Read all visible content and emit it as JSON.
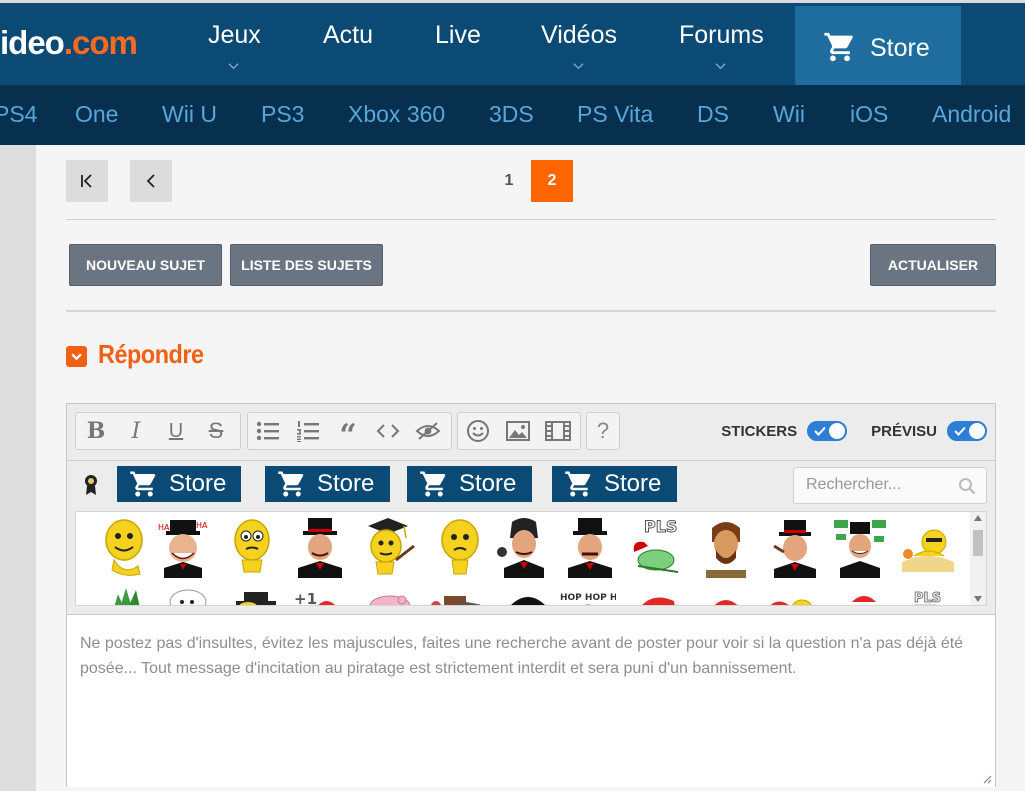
{
  "header": {
    "logo_main": "ideo",
    "logo_dot": ".com",
    "nav": [
      {
        "label": "Jeux",
        "has_dropdown": true
      },
      {
        "label": "Actu",
        "has_dropdown": false
      },
      {
        "label": "Live",
        "has_dropdown": false
      },
      {
        "label": "Vidéos",
        "has_dropdown": true
      },
      {
        "label": "Forums",
        "has_dropdown": true
      }
    ],
    "store_label": "Store",
    "icon": "cart-icon"
  },
  "platforms": [
    "PS4",
    "One",
    "Wii U",
    "PS3",
    "Xbox 360",
    "3DS",
    "PS Vita",
    "DS",
    "Wii",
    "iOS",
    "Android"
  ],
  "pagination": {
    "first_icon": "first-page-icon",
    "prev_icon": "prev-page-icon",
    "pages": [
      "1",
      "2"
    ],
    "current": "2"
  },
  "actions": {
    "new_topic": "NOUVEAU SUJET",
    "topic_list": "LISTE DES SUJETS",
    "refresh": "ACTUALISER"
  },
  "reply": {
    "title": "Répondre",
    "icon": "chevron-down-icon"
  },
  "editor": {
    "toolbar": [
      "bold-icon",
      "italic-icon",
      "underline-icon",
      "strike-icon",
      "bullet-list-icon",
      "numbered-list-icon",
      "quote-icon",
      "code-icon",
      "spoiler-icon",
      "smiley-icon",
      "image-icon",
      "video-icon",
      "help-icon"
    ],
    "toggles": [
      {
        "label": "STICKERS",
        "on": true
      },
      {
        "label": "PRÉVISU",
        "on": true
      }
    ],
    "sticker_tabs": [
      "Store",
      "Store",
      "Store",
      "Store"
    ],
    "award_icon": "ribbon-icon",
    "search_placeholder": "Rechercher...",
    "second_row_text": "HOP HOP HOP",
    "pls_text": "PLS",
    "plus_one": "+1",
    "placeholder": "Ne postez pas d'insultes, évitez les majuscules, faites une recherche avant de poster pour voir si la question n'a pas déjà été posée... Tout message d'incitation au piratage est strictement interdit et sera puni d'un bannissement."
  },
  "colors": {
    "nav_bg": "#0b4a75",
    "platform_bg": "#07304e",
    "accent": "#ff6500",
    "button_bg": "#6b7581",
    "toggle": "#2d7ed4"
  }
}
